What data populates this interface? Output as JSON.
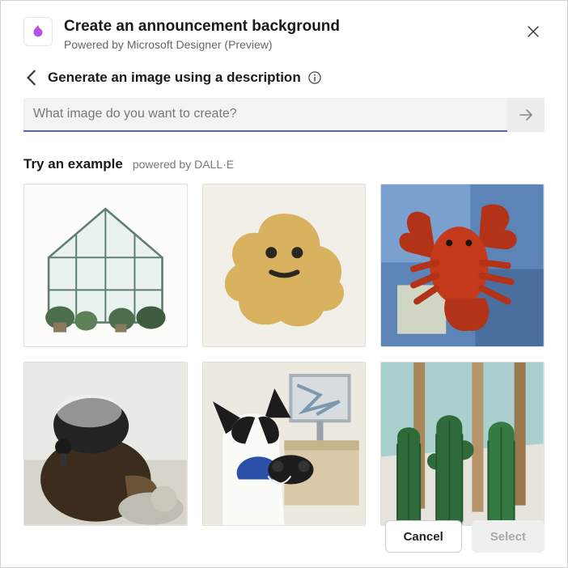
{
  "header": {
    "title": "Create an announcement background",
    "subtitle": "Powered by Microsoft Designer (Preview)"
  },
  "breadcrumb": {
    "label": "Generate an image using a description"
  },
  "input": {
    "placeholder": "What image do you want to create?",
    "value": ""
  },
  "examples": {
    "try_label": "Try an example",
    "powered_label": "powered by DALL·E",
    "items": [
      {
        "name": "greenhouse-watercolor"
      },
      {
        "name": "fuzzy-sponge-character"
      },
      {
        "name": "lobster-painting"
      },
      {
        "name": "bear-with-helmet"
      },
      {
        "name": "cat-playing-videogame"
      },
      {
        "name": "cacti-palms"
      }
    ]
  },
  "footer": {
    "cancel_label": "Cancel",
    "select_label": "Select"
  }
}
